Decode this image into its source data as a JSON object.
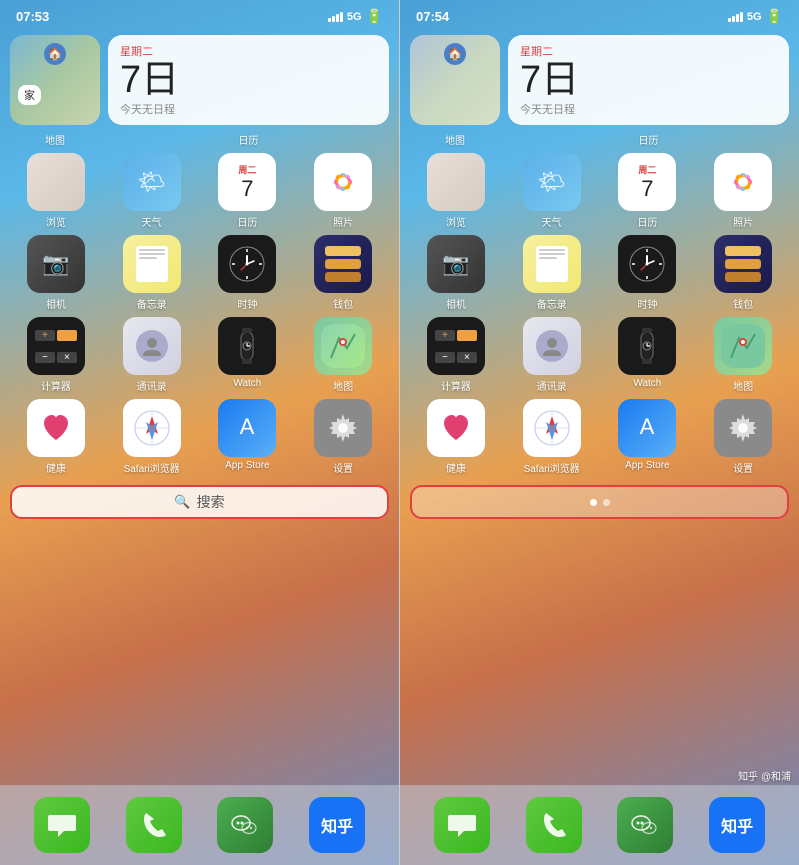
{
  "left_screen": {
    "time": "07:53",
    "signal": "5G",
    "widgets": {
      "map_label": "家",
      "map_name": "地图",
      "cal_day": "星期二",
      "cal_date": "7日",
      "cal_no_event": "今天无日程",
      "cal_name": "日历"
    },
    "apps_row1": [
      {
        "label": "浏览",
        "icon": "browse"
      },
      {
        "label": "天气",
        "icon": "weather"
      },
      {
        "label": "日历",
        "icon": "calendar"
      },
      {
        "label": "照片",
        "icon": "photos"
      }
    ],
    "apps_row2": [
      {
        "label": "相机",
        "icon": "camera"
      },
      {
        "label": "备忘录",
        "icon": "notes"
      },
      {
        "label": "时钟",
        "icon": "clock"
      },
      {
        "label": "钱包",
        "icon": "wallet"
      }
    ],
    "apps_row3": [
      {
        "label": "计算器",
        "icon": "calc"
      },
      {
        "label": "通讯录",
        "icon": "contacts"
      },
      {
        "label": "Watch",
        "icon": "watch"
      },
      {
        "label": "地图",
        "icon": "maps"
      }
    ],
    "apps_row4": [
      {
        "label": "健康",
        "icon": "health"
      },
      {
        "label": "Safari浏览器",
        "icon": "safari"
      },
      {
        "label": "App Store",
        "icon": "appstore"
      },
      {
        "label": "设置",
        "icon": "settings"
      }
    ],
    "search_placeholder": "搜索",
    "dock": {
      "apps": [
        {
          "label": "信息",
          "icon": "messages"
        },
        {
          "label": "电话",
          "icon": "phone"
        },
        {
          "label": "微信",
          "icon": "wechat"
        },
        {
          "label": "知乎",
          "icon": "zhihu"
        }
      ]
    }
  },
  "right_screen": {
    "time": "07:54",
    "signal": "5G",
    "widgets": {
      "map_label": "",
      "map_name": "地图",
      "cal_day": "星期二",
      "cal_date": "7日",
      "cal_no_event": "今天无日程",
      "cal_name": "日历"
    },
    "apps_row1": [
      {
        "label": "浏览",
        "icon": "browse"
      },
      {
        "label": "天气",
        "icon": "weather"
      },
      {
        "label": "日历",
        "icon": "calendar"
      },
      {
        "label": "照片",
        "icon": "photos"
      }
    ],
    "apps_row2": [
      {
        "label": "相机",
        "icon": "camera"
      },
      {
        "label": "备忘录",
        "icon": "notes"
      },
      {
        "label": "时钟",
        "icon": "clock"
      },
      {
        "label": "钱包",
        "icon": "wallet"
      }
    ],
    "apps_row3": [
      {
        "label": "计算器",
        "icon": "calc"
      },
      {
        "label": "通讯录",
        "icon": "contacts"
      },
      {
        "label": "Watch",
        "icon": "watch"
      },
      {
        "label": "地图",
        "icon": "maps"
      }
    ],
    "apps_row4": [
      {
        "label": "健康",
        "icon": "health"
      },
      {
        "label": "Safari浏览器",
        "icon": "safari"
      },
      {
        "label": "App Store",
        "icon": "appstore"
      },
      {
        "label": "设置",
        "icon": "settings"
      }
    ],
    "page_indicator": "dots",
    "dock": {
      "apps": [
        {
          "label": "信息",
          "icon": "messages"
        },
        {
          "label": "电话",
          "icon": "phone"
        },
        {
          "label": "微信",
          "icon": "wechat"
        },
        {
          "label": "知乎",
          "icon": "zhihu"
        }
      ]
    }
  },
  "watermark": {
    "line1": "知乎 @和浦"
  }
}
